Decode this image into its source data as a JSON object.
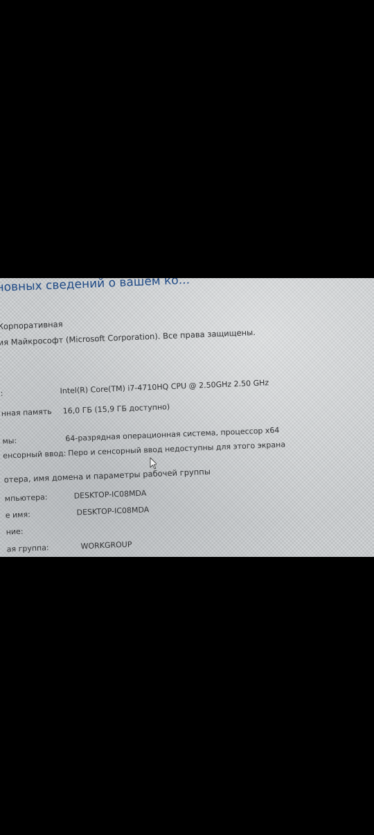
{
  "system_page": {
    "heading": "новных сведений о вашем ко...",
    "edition": "Корпоративная",
    "copyright": "ия Майкрософт (Microsoft Corporation). Все права защищены.",
    "rows": [
      {
        "label": ":",
        "value": "Intel(R) Core(TM) i7-4710HQ CPU @ 2.50GHz   2.50 GHz"
      },
      {
        "label": "нная память",
        "value": "16,0 ГБ (15,9 ГБ доступно)"
      },
      {
        "label": "мы:",
        "value": "64-разрядная операционная система, процессор x64"
      },
      {
        "label": "енсорный ввод:",
        "value": "Перо и сенсорный ввод недоступны для этого экрана"
      }
    ],
    "section_title": "отера, имя домена и параметры рабочей группы",
    "computer_rows": [
      {
        "label": "мпьютера:",
        "value": "DESKTOP-IC08MDA"
      },
      {
        "label": "е имя:",
        "value": "DESKTOP-IC08MDA"
      },
      {
        "label": "ние:",
        "value": ""
      },
      {
        "label": "ая группа:",
        "value": "WORKGROUP"
      }
    ]
  },
  "colors": {
    "letterbox": "#000000",
    "screen_background": "#cfd2d4",
    "heading_color": "#1f4a86",
    "text_color": "#2e2f31"
  },
  "icons": {
    "cursor": "arrow-cursor-icon"
  }
}
